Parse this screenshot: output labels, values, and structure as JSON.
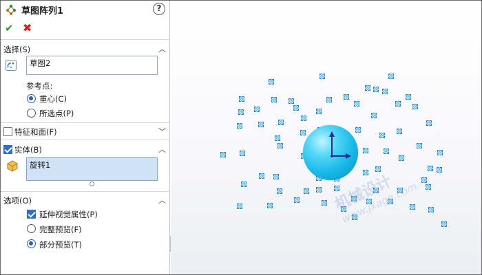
{
  "window": {
    "title": "草图阵列1"
  },
  "header": {
    "help_label": "?",
    "ok_label": "✔",
    "cancel_label": "✖"
  },
  "sections": {
    "selection": {
      "title": "选择(S)",
      "sketch_value": "草图2",
      "reference_label": "参考点:",
      "options": [
        {
          "label": "重心(C)",
          "checked": true
        },
        {
          "label": "所选点(P)",
          "checked": false
        }
      ]
    },
    "features_faces": {
      "title": "特征和面(F)",
      "checked": false
    },
    "bodies": {
      "title": "实体(B)",
      "checked": true,
      "value": "旋转1"
    },
    "options": {
      "title": "选项(O)",
      "items": [
        {
          "label": "延伸视觉属性(P)",
          "type": "checkbox",
          "checked": true
        },
        {
          "label": "完整预览(F)",
          "type": "radio",
          "checked": false
        },
        {
          "label": "部分预览(T)",
          "type": "radio",
          "checked": true
        }
      ]
    }
  },
  "viewport": {
    "watermark_line1": "机械设计",
    "watermark_line2": "www.jxage.com"
  },
  "colors": {
    "accent": "#2b6fc9",
    "sphere": "#17b8e8",
    "ok": "#2f9a2f",
    "cancel": "#d32020"
  }
}
